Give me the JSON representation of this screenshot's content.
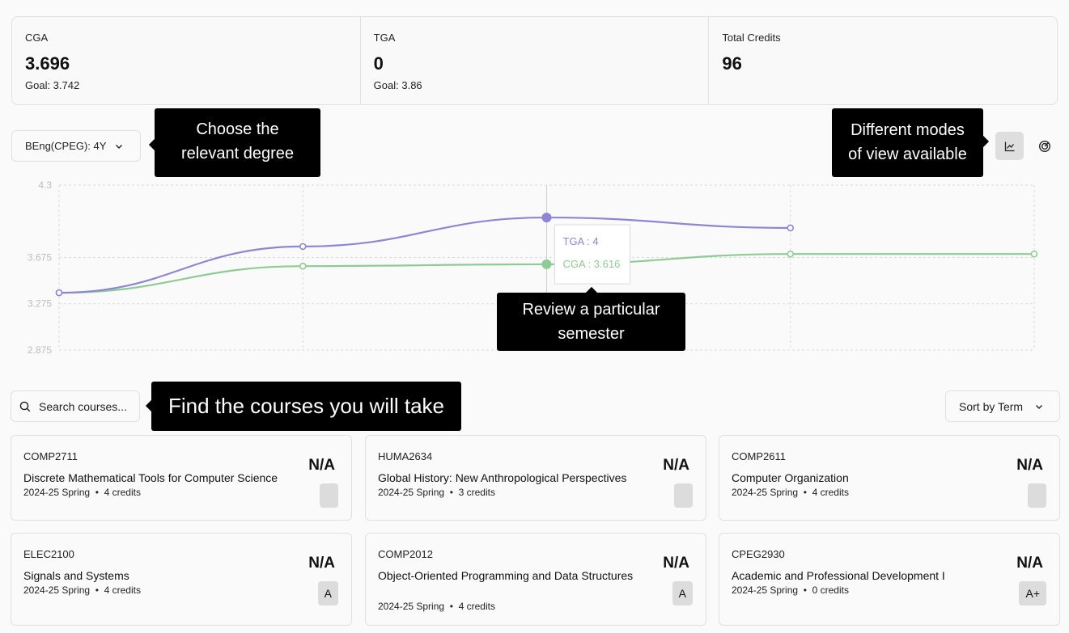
{
  "stats": [
    {
      "label": "CGA",
      "value": "3.696",
      "goal": "Goal: 3.742"
    },
    {
      "label": "TGA",
      "value": "0",
      "goal": "Goal: 3.86"
    },
    {
      "label": "Total Credits",
      "value": "96",
      "goal": ""
    }
  ],
  "degree_select": {
    "value": "BEng(CPEG): 4Y",
    "icon": "chevron-down-icon"
  },
  "tooltips": {
    "degree_line1": "Choose the",
    "degree_line2": "relevant degree",
    "modes_line1": "Different modes",
    "modes_line2": "of view available",
    "semester_line1": "Review a particular",
    "semester_line2": "semester",
    "courses": "Find the courses you will take"
  },
  "view_modes": [
    {
      "name": "line-chart-icon",
      "active": true
    },
    {
      "name": "radar-chart-icon",
      "active": false
    }
  ],
  "chart_data": {
    "type": "line",
    "x": [
      1,
      2,
      3,
      4,
      5
    ],
    "ylim": [
      2.875,
      4.3
    ],
    "yticks": [
      "4.3",
      "3.675",
      "3.275",
      "2.875"
    ],
    "ytick_values": [
      4.3,
      3.675,
      3.275,
      2.875
    ],
    "series": [
      {
        "name": "TGA",
        "color": "#8c86d4",
        "values": [
          3.37,
          3.77,
          4.02,
          3.93
        ]
      },
      {
        "name": "CGA",
        "color": "#8fcb95",
        "values": [
          3.37,
          3.6,
          3.616,
          3.705,
          3.705
        ]
      }
    ],
    "hover": {
      "index": 2,
      "tga_label": "TGA : 4",
      "cga_label": "CGA : 3.616"
    }
  },
  "search": {
    "placeholder": "Search courses..."
  },
  "sort": {
    "label": "Sort by Term"
  },
  "courses": [
    {
      "code": "COMP2711",
      "title": "Discrete Mathematical Tools for Computer Science",
      "term": "2024-25 Spring",
      "credits": "4 credits",
      "grade": "N/A",
      "target": ""
    },
    {
      "code": "HUMA2634",
      "title": "Global History: New Anthropological Perspectives",
      "term": "2024-25 Spring",
      "credits": "3 credits",
      "grade": "N/A",
      "target": ""
    },
    {
      "code": "COMP2611",
      "title": "Computer Organization",
      "term": "2024-25 Spring",
      "credits": "4 credits",
      "grade": "N/A",
      "target": ""
    },
    {
      "code": "ELEC2100",
      "title": "Signals and Systems",
      "term": "2024-25 Spring",
      "credits": "4 credits",
      "grade": "N/A",
      "target": "A"
    },
    {
      "code": "COMP2012",
      "title": "Object-Oriented Programming and Data Structures",
      "term": "2024-25 Spring",
      "credits": "4 credits",
      "grade": "N/A",
      "target": "A"
    },
    {
      "code": "CPEG2930",
      "title": "Academic and Professional Development I",
      "term": "2024-25 Spring",
      "credits": "0 credits",
      "grade": "N/A",
      "target": "A+"
    }
  ]
}
